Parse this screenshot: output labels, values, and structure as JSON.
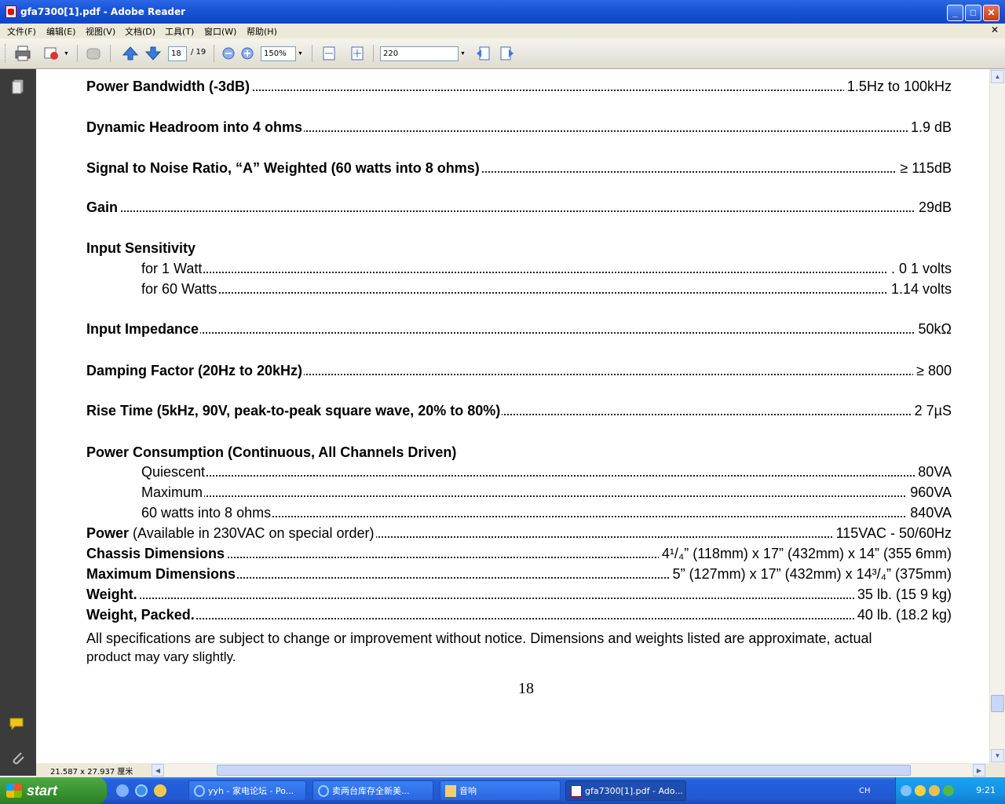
{
  "window": {
    "title": "gfa7300[1].pdf - Adobe Reader",
    "min_label": "_",
    "max_label": "□",
    "close_label": "✕",
    "doc_close_label": "✕"
  },
  "menu": [
    "文件(F)",
    "编辑(E)",
    "视图(V)",
    "文档(D)",
    "工具(T)",
    "窗口(W)",
    "帮助(H)"
  ],
  "toolbar": {
    "current_page": "18",
    "page_total": "/ 19",
    "zoom": "150%",
    "search_value": "220"
  },
  "document": {
    "rows": [
      {
        "label": "Power Bandwidth (-3dB)",
        "value": "1.5Hz to 100kHz"
      },
      {
        "label": "Dynamic Headroom into 4 ohms",
        "value": "1.9 dB"
      },
      {
        "label": "Signal to Noise Ratio, “A” Weighted (60 watts into 8 ohms)",
        "value": "≥ 115dB"
      },
      {
        "label": "Gain",
        "value": "29dB"
      },
      {
        "label": "Input Sensitivity"
      },
      {
        "label": "for 1 Watt",
        "value": ". 0 1 volts"
      },
      {
        "label": "for 60 Watts",
        "value": "1.14 volts"
      },
      {
        "label": "Input Impedance",
        "value": "50kΩ"
      },
      {
        "label": "Damping Factor (20Hz to 20kHz)",
        "value": "≥ 800"
      },
      {
        "label": "Rise Time (5kHz, 90V, peak-to-peak square wave, 20% to 80%)",
        "value": "2 7µS"
      },
      {
        "label": "Power Consumption (Continuous, All Channels Driven)"
      },
      {
        "label": "Quiescent",
        "value": "80VA"
      },
      {
        "label": "Maximum",
        "value": "960VA"
      },
      {
        "label": "60 watts into 8 ohms",
        "value": "840VA"
      },
      {
        "label": "Power",
        "label_suffix": " (Available in 230VAC on special order)",
        "value": "115VAC - 50/60Hz"
      },
      {
        "label": "Chassis Dimensions",
        "value": "4¹/₄” (118mm) x 17” (432mm) x 14” (355 6mm)"
      },
      {
        "label": "Maximum Dimensions",
        "value": "5” (127mm) x 17” (432mm) x 14³/₄” (375mm)"
      },
      {
        "label": "Weight.",
        "value": "35 lb. (15 9 kg)"
      },
      {
        "label": "Weight, Packed.",
        "value": "40 lb. (18.2 kg)"
      }
    ],
    "note_line1": "All specifications are subject to change or improvement without notice.  Dimensions and weights listed are approximate, actual",
    "note_line2": "product may vary slightly.",
    "page_number": "18"
  },
  "status": {
    "page_size": "21.587 x 27.937 厘米"
  },
  "taskbar": {
    "start_label": "start",
    "tasks": [
      "yyh - 家电论坛 - Po...",
      "卖两台库存全新美...",
      "音响",
      "gfa7300[1].pdf - Ado..."
    ],
    "active_task": 3,
    "lang": "CH",
    "clock": "9:21"
  },
  "colors": {
    "titlebar": "#0c45c6",
    "taskbar": "#2258d4",
    "navpane": "#3b3b3b"
  }
}
